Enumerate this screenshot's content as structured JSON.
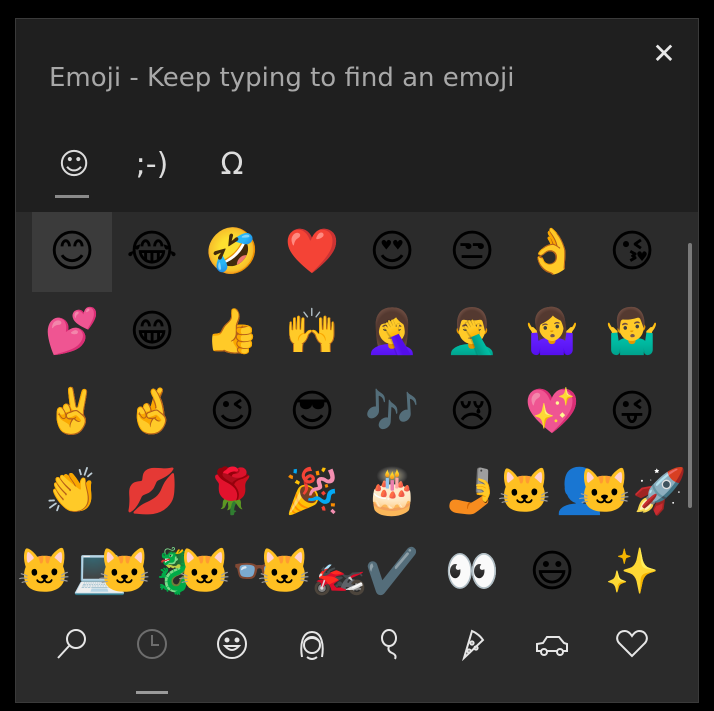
{
  "panel": {
    "title": "Emoji - Keep typing to find an emoji",
    "close_glyph": "✕"
  },
  "category_tabs": [
    {
      "name": "emoji",
      "glyph": "☺",
      "selected": true
    },
    {
      "name": "kaomoji",
      "glyph": ";-)",
      "selected": false
    },
    {
      "name": "symbols",
      "glyph": "Ω",
      "selected": false
    }
  ],
  "emoji_grid": [
    "😊",
    "😂",
    "🤣",
    "❤️",
    "😍",
    "😒",
    "👌",
    "😘",
    "💕",
    "😁",
    "👍",
    "🙌",
    "🤦‍♀️",
    "🤦‍♂️",
    "🤷‍♀️",
    "🤷‍♂️",
    "✌️",
    "🤞",
    "😉",
    "😎",
    "🎶",
    "😢",
    "💖",
    "😜",
    "👏",
    "💋",
    "🌹",
    "🎉",
    "🎂",
    "🤳",
    "🐱‍👤",
    "🐱‍🚀",
    "🐱‍💻",
    "🐱‍🐉",
    "🐱‍👓",
    "🐱‍🏍",
    "✔️",
    "👀",
    "😃",
    "✨"
  ],
  "selected_index": 0,
  "bottom_tabs": [
    {
      "name": "search-icon",
      "selected": false
    },
    {
      "name": "recent-clock-icon",
      "selected": true
    },
    {
      "name": "smiley-icon",
      "selected": false
    },
    {
      "name": "people-icon",
      "selected": false
    },
    {
      "name": "balloon-icon",
      "selected": false
    },
    {
      "name": "pizza-icon",
      "selected": false
    },
    {
      "name": "car-icon",
      "selected": false
    },
    {
      "name": "heart-icon",
      "selected": false
    }
  ]
}
